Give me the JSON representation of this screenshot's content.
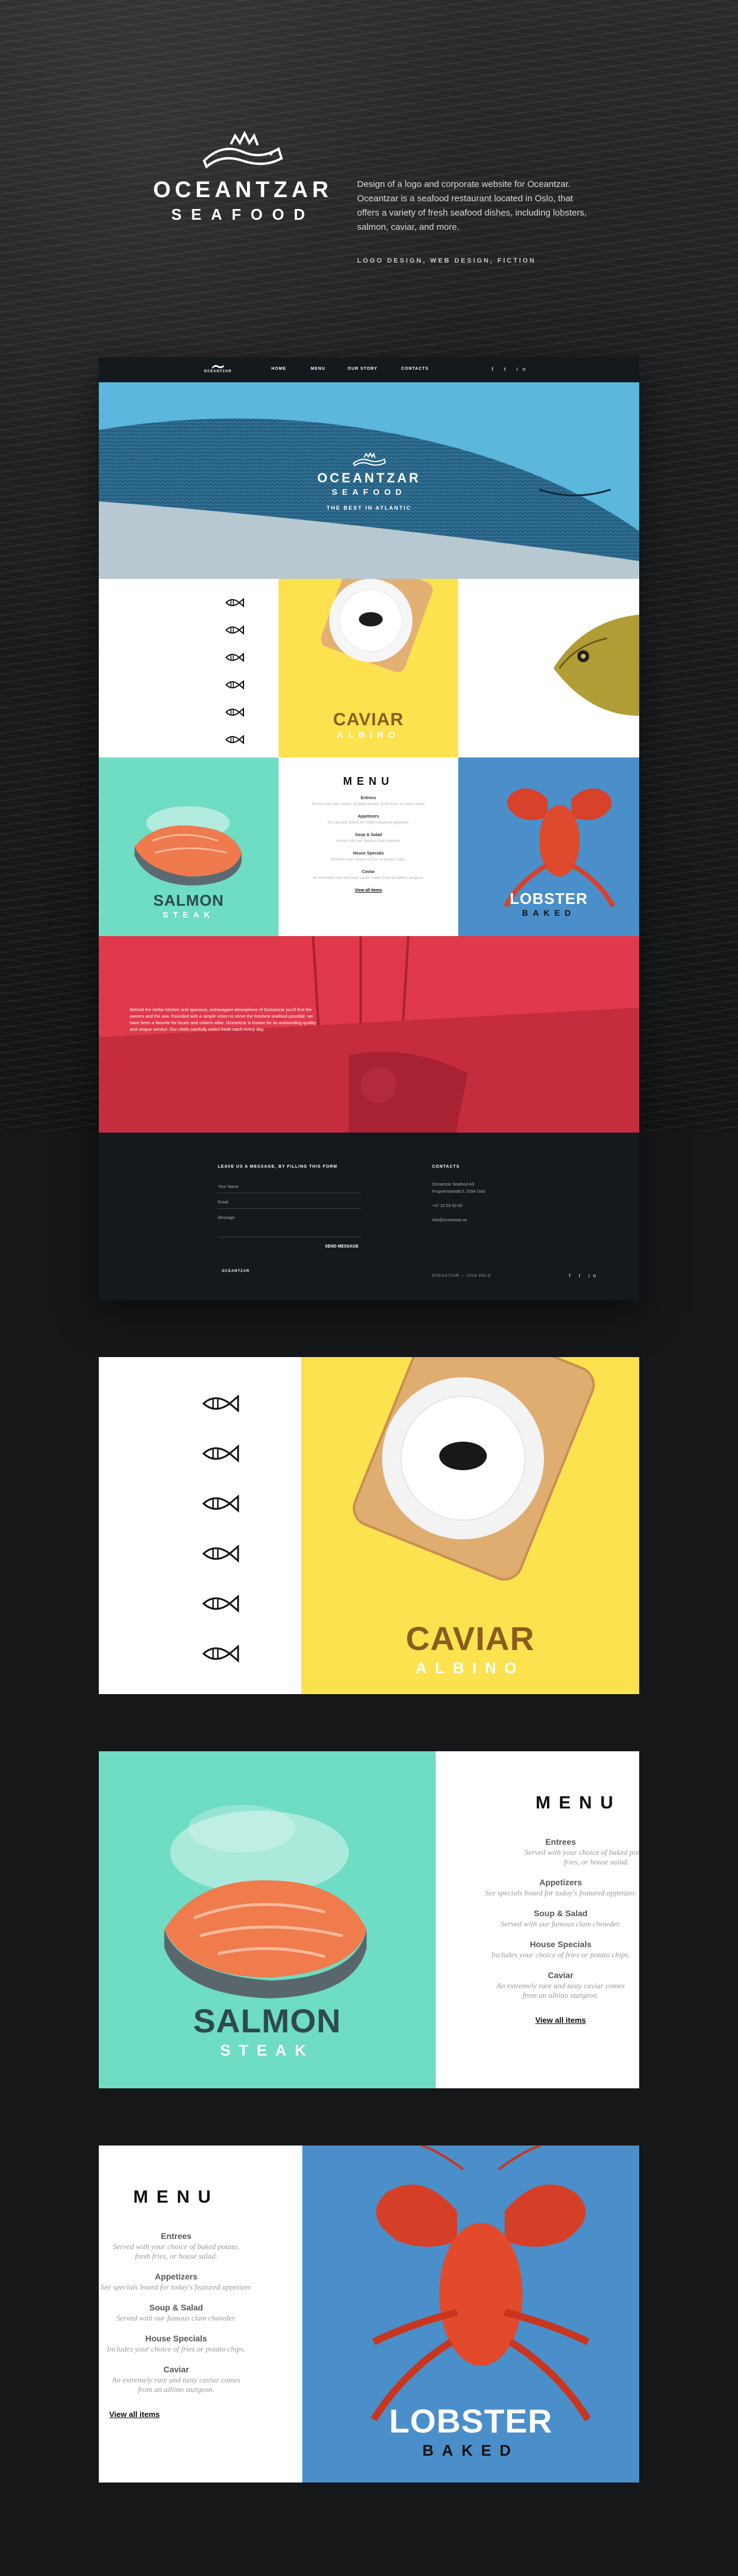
{
  "brand": {
    "line1": "OCEANTZAR",
    "line2": "SEAFOOD"
  },
  "intro": {
    "description": "Design of a logo and corporate website for Oceantzar. Oceantzar is a seafood restaurant located in Oslo, that offers a variety of fresh seafood dishes, including lobsters, salmon, caviar, and more.",
    "tags": "LOGO DESIGN, WEB DESIGN, FICTION"
  },
  "nav": {
    "logo_text": "OCEANTZAR",
    "items": [
      "HOME",
      "MENU",
      "OUR STORY",
      "CONTACTS"
    ],
    "social": "f  t  in"
  },
  "hero": {
    "title": "OCEANTZAR",
    "subtitle": "SEAFOOD",
    "tagline": "THE BEST IN ATLANTIC"
  },
  "dishes": {
    "caviar": {
      "name": "CAVIAR",
      "variant": "ALBINO"
    },
    "salmon": {
      "name": "SALMON",
      "variant": "STEAK"
    },
    "lobster": {
      "name": "LOBSTER",
      "variant": "BAKED"
    }
  },
  "menu": {
    "title": "MENU",
    "items": [
      {
        "name": "Entrees",
        "desc": "Served with your choice of baked potato, fresh fries, or house salad."
      },
      {
        "name": "Appetizers",
        "desc": "See specials board for today's featured appetizer."
      },
      {
        "name": "Soup & Salad",
        "desc": "Served with our famous clam chowder."
      },
      {
        "name": "House Specials",
        "desc": "Includes your choice of fries or potato chips."
      },
      {
        "name": "Caviar",
        "desc": "An extremely rare and tasty caviar comes from an albino sturgeon."
      }
    ],
    "view_all": "View all items"
  },
  "story": {
    "text": "Behind the stellar kitchen and spacious, extravagant atmosphere of Oceantzar you'll find the owners and the sea. Founded with a simple vision to serve the freshest seafood possible, we have been a favorite for locals and visitors alike. Oceantzar is known for its outstanding quality and unique service. Our chefs carefully select fresh catch every day."
  },
  "contact": {
    "title": "LEAVE US A MESSAGE, BY FILLING THIS FORM",
    "fields": [
      "Your Name",
      "Email",
      "Message"
    ],
    "send": "SEND MESSAGE",
    "right_title": "CONTACTS",
    "lines": [
      "Oceantzar Seafood AS",
      "Frognerstranda 5, 0264 Oslo",
      "+47 22 55 00 00",
      "info@oceantzar.no"
    ],
    "footer_right": "OCEANTZAR — 2016 OSLO",
    "footer_social": "f t in"
  },
  "colors": {
    "yellow": "#fde24f",
    "teal": "#6fdcc4",
    "blue": "#4a8fc9",
    "red": "#e0394b",
    "navy": "#13191c",
    "hero_blue": "#5bb7dc",
    "caviar_text": "#8a5c1d",
    "salmon_text": "#2d4a50"
  }
}
